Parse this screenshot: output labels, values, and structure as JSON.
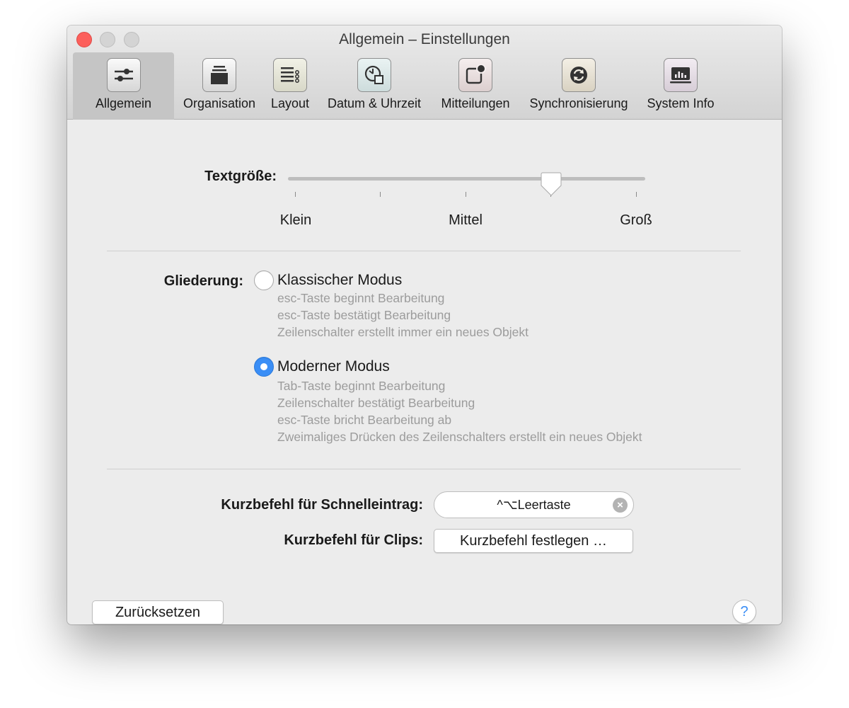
{
  "window": {
    "title": "Allgemein – Einstellungen"
  },
  "toolbar": {
    "tabs": [
      {
        "label": "Allgemein",
        "icon": "sliders-icon",
        "active": true
      },
      {
        "label": "Organisation",
        "icon": "stack-icon",
        "active": false
      },
      {
        "label": "Layout",
        "icon": "layout-list-icon",
        "active": false
      },
      {
        "label": "Datum & Uhrzeit",
        "icon": "clock-icon",
        "active": false
      },
      {
        "label": "Mitteilungen",
        "icon": "notification-badge-icon",
        "active": false
      },
      {
        "label": "Synchronisierung",
        "icon": "sync-icon",
        "active": false
      },
      {
        "label": "System Info",
        "icon": "chart-monitor-icon",
        "active": false
      }
    ]
  },
  "textsize": {
    "label": "Textgröße:",
    "ticks": [
      "Klein",
      "Mittel",
      "Groß"
    ],
    "value_step": 3,
    "step_count": 5
  },
  "outline": {
    "label": "Gliederung:",
    "classic": {
      "title": "Klassischer Modus",
      "selected": false,
      "lines": [
        "esc-Taste beginnt Bearbeitung",
        "esc-Taste bestätigt Bearbeitung",
        "Zeilenschalter erstellt immer ein neues Objekt"
      ]
    },
    "modern": {
      "title": "Moderner Modus",
      "selected": true,
      "lines": [
        "Tab-Taste beginnt Bearbeitung",
        "Zeilenschalter bestätigt Bearbeitung",
        "esc-Taste bricht Bearbeitung ab",
        "Zweimaliges Drücken des Zeilenschalters erstellt ein neues Objekt"
      ]
    }
  },
  "shortcuts": {
    "quick_entry_label": "Kurzbefehl für Schnelleintrag:",
    "quick_entry_value": "^⌥Leertaste",
    "clips_label": "Kurzbefehl für Clips:",
    "clips_button": "Kurzbefehl festlegen …"
  },
  "footer": {
    "reset_button": "Zurücksetzen",
    "help_button": "?"
  },
  "colors": {
    "accent": "#3a8ef6",
    "close": "#fc605c",
    "secondary_text": "#9c9c9c"
  }
}
